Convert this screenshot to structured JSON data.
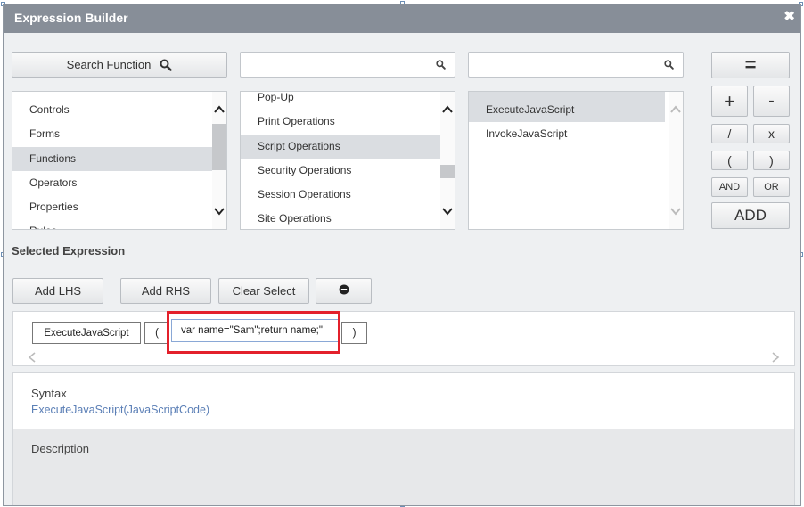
{
  "dialog": {
    "title": "Expression Builder",
    "close_icon": "close-icon"
  },
  "toolbar": {
    "search_function_label": "Search Function",
    "search1_placeholder": "",
    "search2_placeholder": ""
  },
  "lists": {
    "categories": [
      "Controls",
      "Forms",
      "Functions",
      "Operators",
      "Properties",
      "Rules"
    ],
    "categories_selected": "Functions",
    "groups": [
      "Pop-Up",
      "Print Operations",
      "Script Operations",
      "Security Operations",
      "Session Operations",
      "Site Operations"
    ],
    "groups_selected": "Script Operations",
    "functions": [
      "ExecuteJavaScript",
      "InvokeJavaScript"
    ],
    "functions_selected": "ExecuteJavaScript"
  },
  "operators": {
    "equals": "=",
    "plus": "+",
    "minus": "-",
    "divide": "/",
    "multiply": "x",
    "open_paren": "(",
    "close_paren": ")",
    "and": "AND",
    "or": "OR",
    "add": "ADD"
  },
  "selected_expression": {
    "label": "Selected Expression",
    "add_lhs": "Add LHS",
    "add_rhs": "Add RHS",
    "clear_select": "Clear Select",
    "tokens": {
      "function": "ExecuteJavaScript",
      "open_paren": "(",
      "argument": "var name=\"Sam\";return name;\"",
      "close_paren": ")"
    }
  },
  "syntax": {
    "title": "Syntax",
    "text": "ExecuteJavaScript(JavaScriptCode)"
  },
  "description": {
    "title": "Description"
  },
  "colors": {
    "title_bar": "#878e98",
    "highlight": "#e3202b",
    "link": "#5b7fb6",
    "selected_row": "#dadde1"
  }
}
